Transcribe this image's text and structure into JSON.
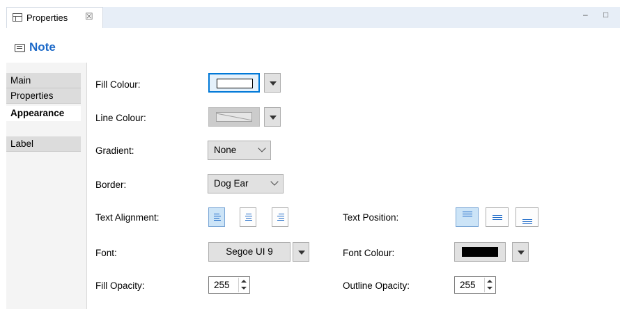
{
  "view": {
    "tab_label": "Properties",
    "close_glyph": "☒",
    "minimize_glyph": "–",
    "maximize_glyph": "□"
  },
  "panel_title": "Note",
  "side_tabs": [
    {
      "label": "Main",
      "active": false
    },
    {
      "label": "Properties",
      "active": false
    },
    {
      "label": "Appearance",
      "active": true
    },
    {
      "label": "Label",
      "active": false
    }
  ],
  "fields": {
    "fill_colour": {
      "label": "Fill Colour:",
      "value": "#ffffff"
    },
    "line_colour": {
      "label": "Line Colour:",
      "enabled": false
    },
    "gradient": {
      "label": "Gradient:",
      "value": "None"
    },
    "border": {
      "label": "Border:",
      "value": "Dog Ear"
    },
    "text_alignment": {
      "label": "Text Alignment:",
      "options": [
        "left",
        "center",
        "right"
      ],
      "selected": "left"
    },
    "text_position": {
      "label": "Text Position:",
      "options": [
        "top",
        "middle",
        "bottom"
      ],
      "selected": "top"
    },
    "font": {
      "label": "Font:",
      "value": "Segoe UI 9"
    },
    "font_colour": {
      "label": "Font Colour:",
      "value": "#000000"
    },
    "fill_opacity": {
      "label": "Fill Opacity:",
      "value": "255"
    },
    "outline_opacity": {
      "label": "Outline Opacity:",
      "value": "255"
    }
  },
  "colors": {
    "accent": "#1c69c8",
    "focus": "#0078d7"
  }
}
